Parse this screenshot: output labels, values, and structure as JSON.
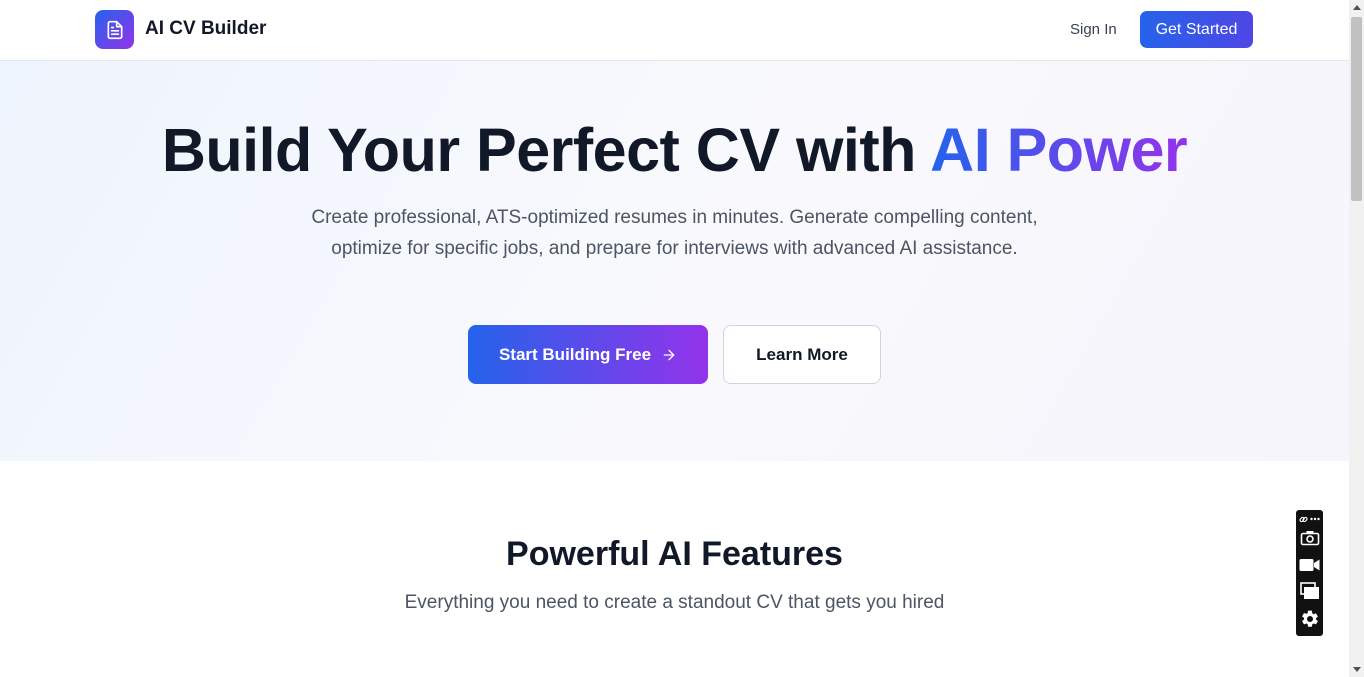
{
  "header": {
    "brand": "AI CV Builder",
    "sign_in": "Sign In",
    "get_started": "Get Started"
  },
  "hero": {
    "title_main": "Build Your Perfect CV with ",
    "title_accent": "AI Power",
    "subtitle": "Create professional, ATS-optimized resumes in minutes. Generate compelling content, optimize for specific jobs, and prepare for interviews with advanced AI assistance.",
    "primary_button": "Start Building Free",
    "secondary_button": "Learn More"
  },
  "features": {
    "title": "Powerful AI Features",
    "subtitle": "Everything you need to create a standout CV that gets you hired"
  },
  "icons": {
    "logo": "document-icon",
    "arrow": "arrow-right-icon",
    "toolbar": [
      "link-icon",
      "more-icon",
      "camera-icon",
      "video-icon",
      "windows-icon",
      "gear-icon"
    ]
  },
  "colors": {
    "accent_start": "#2563eb",
    "accent_end": "#9333ea",
    "text_dark": "#111827",
    "text_muted": "#4b5563"
  }
}
